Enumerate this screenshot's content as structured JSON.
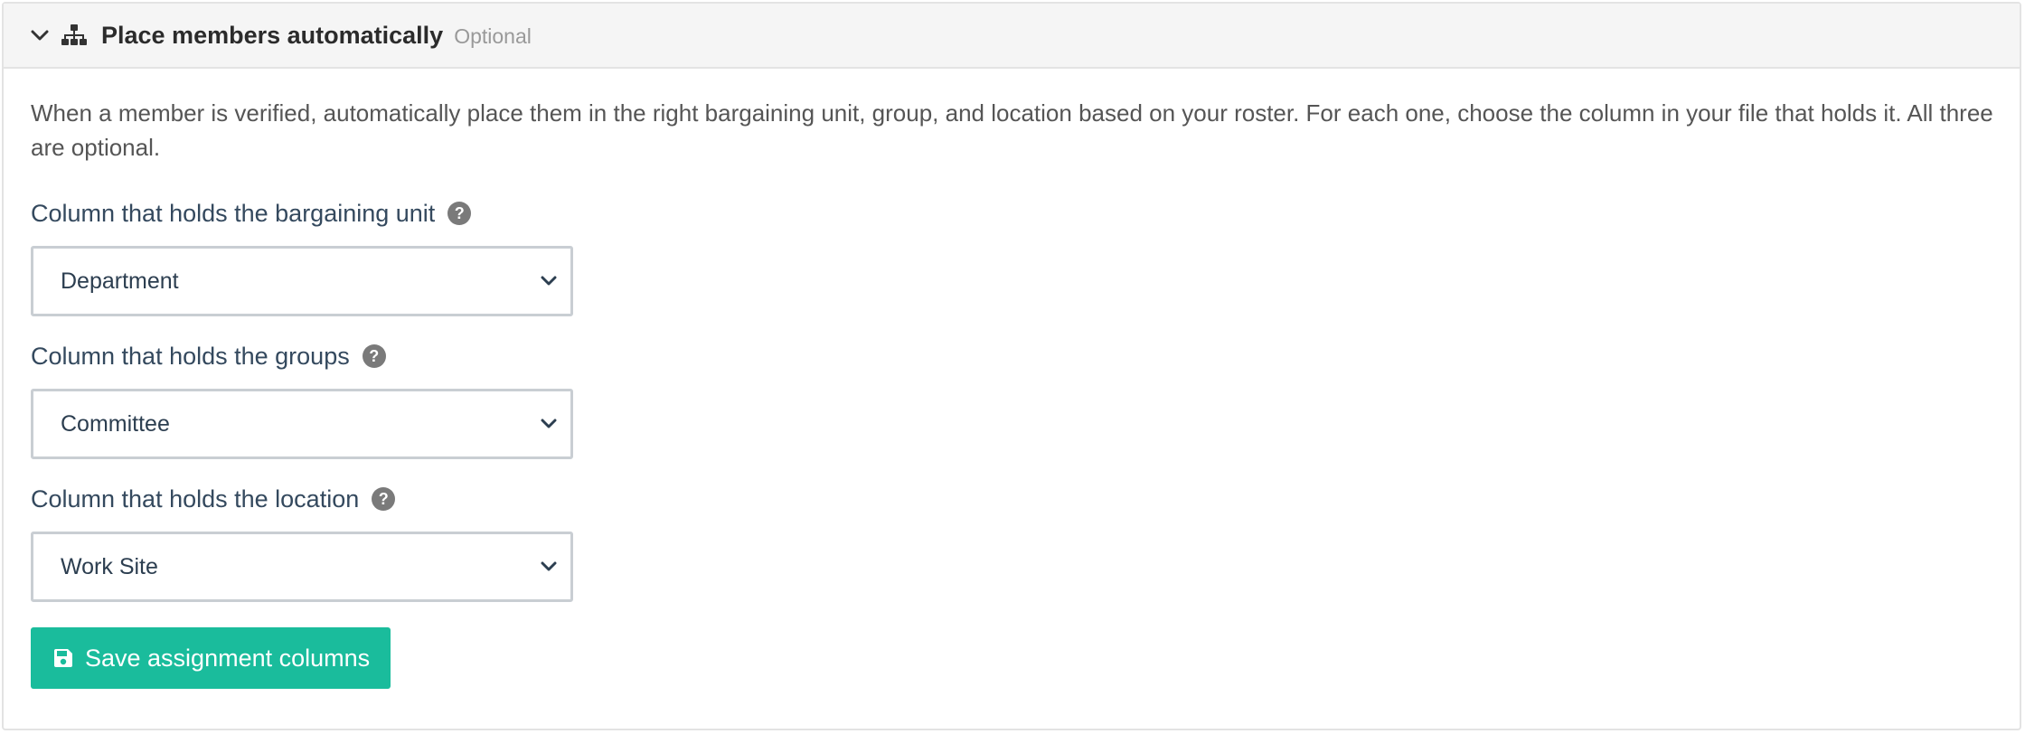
{
  "header": {
    "title": "Place members automatically",
    "badge": "Optional",
    "collapse_icon": "chevron-down-icon",
    "section_icon": "sitemap-icon"
  },
  "description": "When a member is verified, automatically place them in the right bargaining unit, group, and location based on your roster. For each one, choose the column in your file that holds it. All three are optional.",
  "fields": [
    {
      "label": "Column that holds the bargaining unit",
      "help": "?",
      "value": "Department"
    },
    {
      "label": "Column that holds the groups",
      "help": "?",
      "value": "Committee"
    },
    {
      "label": "Column that holds the location",
      "help": "?",
      "value": "Work Site"
    }
  ],
  "save_button": {
    "label": "Save assignment columns",
    "icon": "floppy-disk-icon",
    "color": "#1abc9c"
  },
  "colors": {
    "header_bg": "#f5f5f5",
    "label_text": "#34495e",
    "accent": "#1abc9c"
  }
}
